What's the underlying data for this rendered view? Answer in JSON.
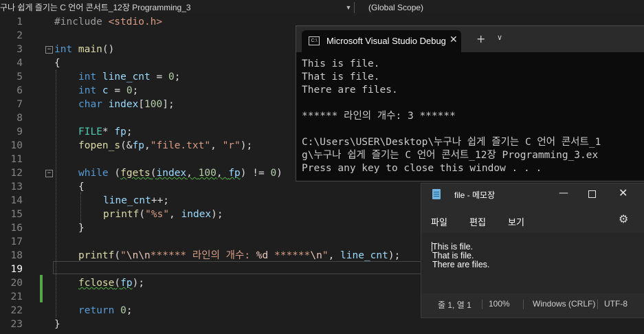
{
  "navbar": {
    "project": "구나 쉽게 즐기는 C 언어 콘서트_12장 Programming_3",
    "scope": "(Global Scope)"
  },
  "editor": {
    "current_line": 19,
    "line_numbers": [
      "1",
      "2",
      "3",
      "4",
      "5",
      "6",
      "7",
      "8",
      "9",
      "10",
      "11",
      "12",
      "13",
      "14",
      "15",
      "16",
      "17",
      "18",
      "19",
      "20",
      "21",
      "22",
      "23"
    ],
    "code": {
      "l1_pp": "#include ",
      "l1_hdr": "<stdio.h>",
      "l3_int": "int",
      "l3_main": " main",
      "l3_rest": "()",
      "l4": "{",
      "l5_type": "int",
      "l5_var": " line_cnt",
      "l5_eq": " = ",
      "l5_num": "0",
      "l5_end": ";",
      "l6_type": "int",
      "l6_var": " c",
      "l6_eq": " = ",
      "l6_num": "0",
      "l6_end": ";",
      "l7_type": "char",
      "l7_var": " index",
      "l7_br1": "[",
      "l7_num": "100",
      "l7_br2": "];",
      "l9_type": "FILE",
      "l9_star": "* ",
      "l9_var": "fp",
      "l9_end": ";",
      "l10_fn": "fopen_s",
      "l10_a": "(&",
      "l10_var": "fp",
      "l10_b": ",",
      "l10_s1": "\"file.txt\"",
      "l10_c": ", ",
      "l10_s2": "\"r\"",
      "l10_d": ");",
      "l12_kw": "while",
      "l12_a": " (",
      "l12_fn": "fgets",
      "l12_b": "(",
      "l12_v1": "index",
      "l12_c": ", ",
      "l12_num1": "100",
      "l12_d": ", ",
      "l12_v2": "fp",
      "l12_e": ") != ",
      "l12_num2": "0",
      "l12_f": ")",
      "l13": "{",
      "l14_var": "line_cnt",
      "l14_end": "++;",
      "l15_fn": "printf",
      "l15_a": "(",
      "l15_s": "\"%s\"",
      "l15_b": ", ",
      "l15_var": "index",
      "l15_c": ");",
      "l16": "}",
      "l18_fn": "printf",
      "l18_a": "(",
      "l18_q1": "\"",
      "l18_esc1": "\\n\\n",
      "l18_s1": "****** 라인의 개수: ",
      "l18_fmt": "%d",
      "l18_s2": " ******",
      "l18_esc2": "\\n",
      "l18_q2": "\"",
      "l18_b": ", ",
      "l18_var": "line_cnt",
      "l18_c": ");",
      "l20_fn": "fclose",
      "l20_a": "(",
      "l20_var": "fp",
      "l20_b": ");",
      "l22_kw": "return",
      "l22_sp": " ",
      "l22_num": "0",
      "l22_end": ";",
      "l23": "}"
    }
  },
  "console": {
    "tab_title": "Microsoft Visual Studio Debug",
    "lines": [
      "This is file.",
      "That is file.",
      "There are files.",
      "",
      "****** 라인의 개수: 3 ******",
      "",
      "C:\\Users\\USER\\Desktop\\누구나 쉽게 즐기는 C 언어 콘서트_1",
      "g\\누구나 쉽게 즐기는 C 언어 콘서트_12장 Programming_3.ex",
      "Press any key to close this window . . ."
    ]
  },
  "notepad": {
    "title": "file - 메모장",
    "menu": [
      "파일",
      "편집",
      "보기"
    ],
    "content": "This is file.\nThat is file.\nThere are files.",
    "status": {
      "position": "줄 1, 열 1",
      "zoom": "100%",
      "line_ending": "Windows (CRLF)",
      "encoding": "UTF-8"
    }
  },
  "colors": {
    "editor_bg": "#1e1e1e",
    "keyword": "#569cd6",
    "type": "#4ec9b0",
    "string": "#d69d85",
    "number": "#b5cea8",
    "function": "#dcdcaa",
    "variable": "#9cdcfe",
    "console_bg": "#0c0c0c",
    "change_marker": "#57a64a"
  }
}
